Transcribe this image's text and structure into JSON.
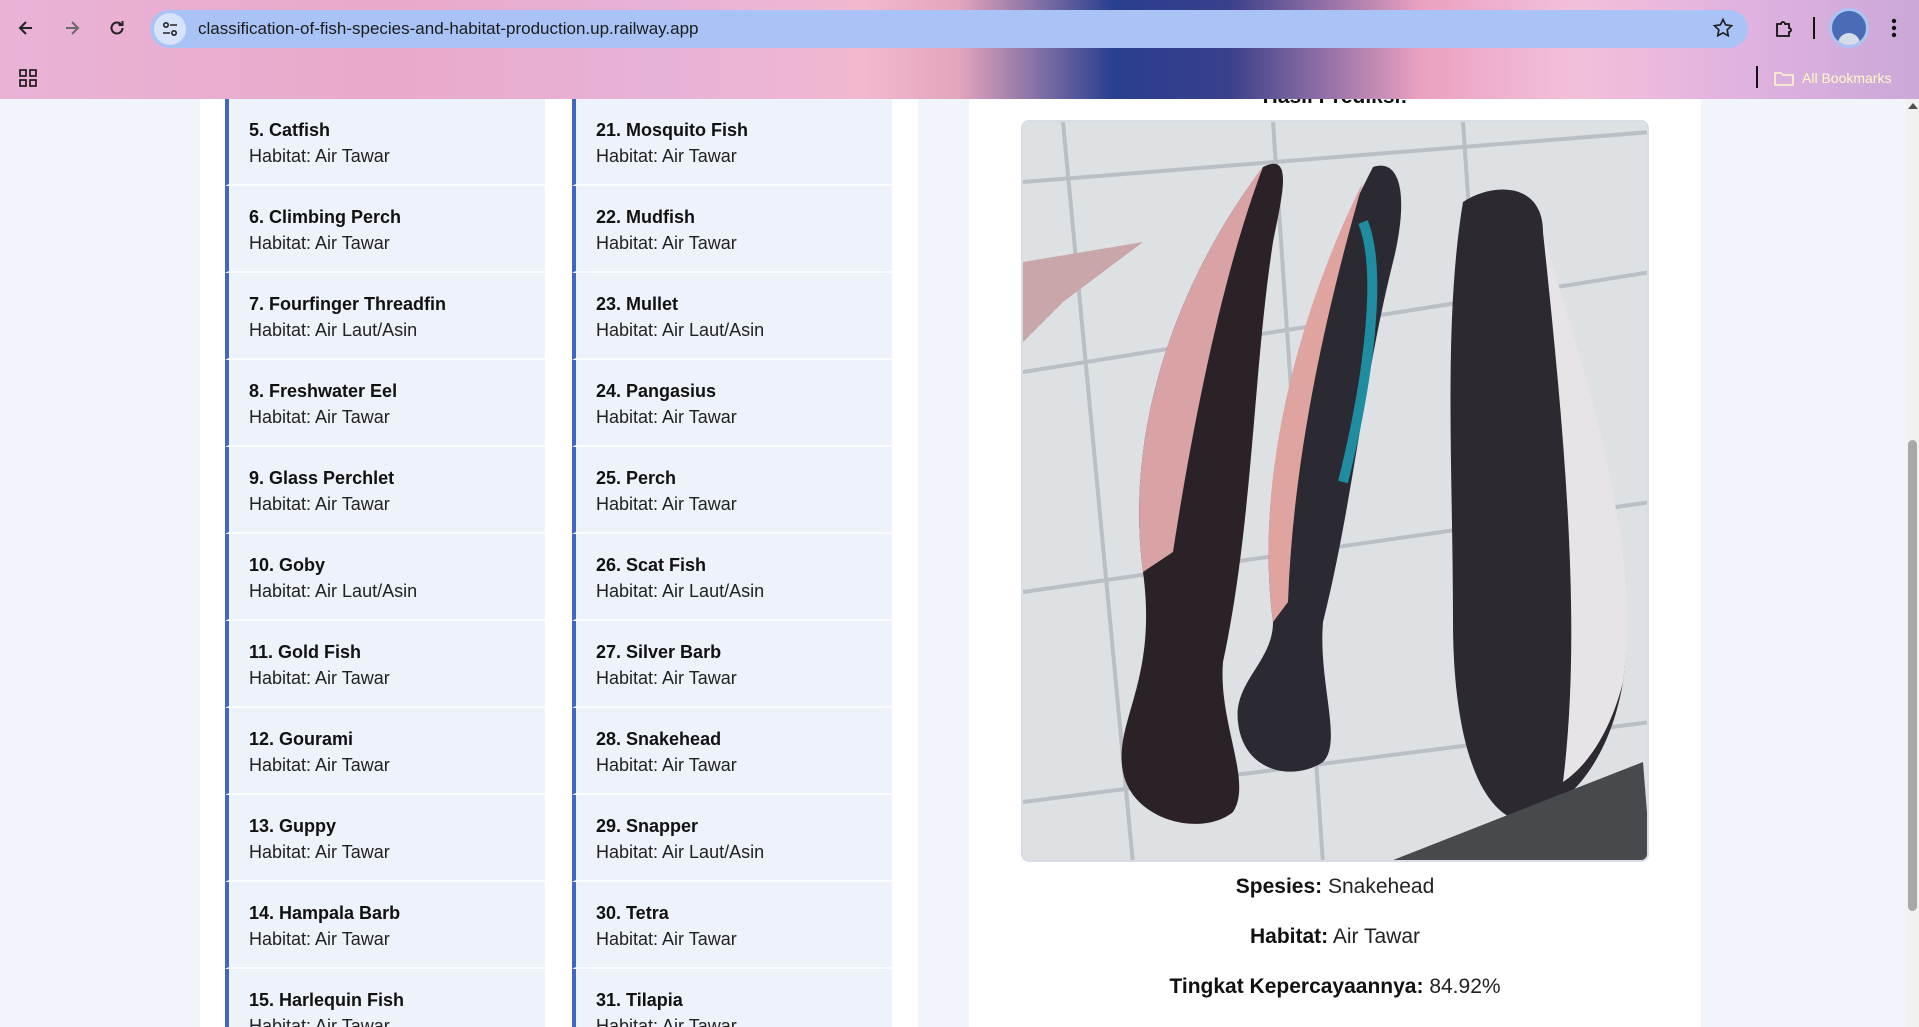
{
  "browser": {
    "url": "classification-of-fish-species-and-habitat-production.up.railway.app",
    "bookmarks_label": "All Bookmarks"
  },
  "fish_list_col1": [
    {
      "name": "5. Catfish",
      "habitat": "Habitat: Air Tawar"
    },
    {
      "name": "6. Climbing Perch",
      "habitat": "Habitat: Air Tawar"
    },
    {
      "name": "7. Fourfinger Threadfin",
      "habitat": "Habitat: Air Laut/Asin"
    },
    {
      "name": "8. Freshwater Eel",
      "habitat": "Habitat: Air Tawar"
    },
    {
      "name": "9. Glass Perchlet",
      "habitat": "Habitat: Air Tawar"
    },
    {
      "name": "10. Goby",
      "habitat": "Habitat: Air Laut/Asin"
    },
    {
      "name": "11. Gold Fish",
      "habitat": "Habitat: Air Tawar"
    },
    {
      "name": "12. Gourami",
      "habitat": "Habitat: Air Tawar"
    },
    {
      "name": "13. Guppy",
      "habitat": "Habitat: Air Tawar"
    },
    {
      "name": "14. Hampala Barb",
      "habitat": "Habitat: Air Tawar"
    },
    {
      "name": "15. Harlequin Fish",
      "habitat": "Habitat: Air Tawar"
    }
  ],
  "fish_list_col2": [
    {
      "name": "21. Mosquito Fish",
      "habitat": "Habitat: Air Tawar"
    },
    {
      "name": "22. Mudfish",
      "habitat": "Habitat: Air Tawar"
    },
    {
      "name": "23. Mullet",
      "habitat": "Habitat: Air Laut/Asin"
    },
    {
      "name": "24. Pangasius",
      "habitat": "Habitat: Air Tawar"
    },
    {
      "name": "25. Perch",
      "habitat": "Habitat: Air Tawar"
    },
    {
      "name": "26. Scat Fish",
      "habitat": "Habitat: Air Laut/Asin"
    },
    {
      "name": "27. Silver Barb",
      "habitat": "Habitat: Air Tawar"
    },
    {
      "name": "28. Snakehead",
      "habitat": "Habitat: Air Tawar"
    },
    {
      "name": "29. Snapper",
      "habitat": "Habitat: Air Laut/Asin"
    },
    {
      "name": "30. Tetra",
      "habitat": "Habitat: Air Tawar"
    },
    {
      "name": "31. Tilapia",
      "habitat": "Habitat: Air Tawar"
    }
  ],
  "result": {
    "title": "Hasil Prediksi:",
    "species_label": "Spesies:",
    "species_value": "Snakehead",
    "habitat_label": "Habitat:",
    "habitat_value": "Air Tawar",
    "confidence_label": "Tingkat Kepercayaannya:",
    "confidence_value": "84.92%"
  },
  "colors": {
    "accent": "#4067c4",
    "card_bg": "#edf2fb"
  }
}
